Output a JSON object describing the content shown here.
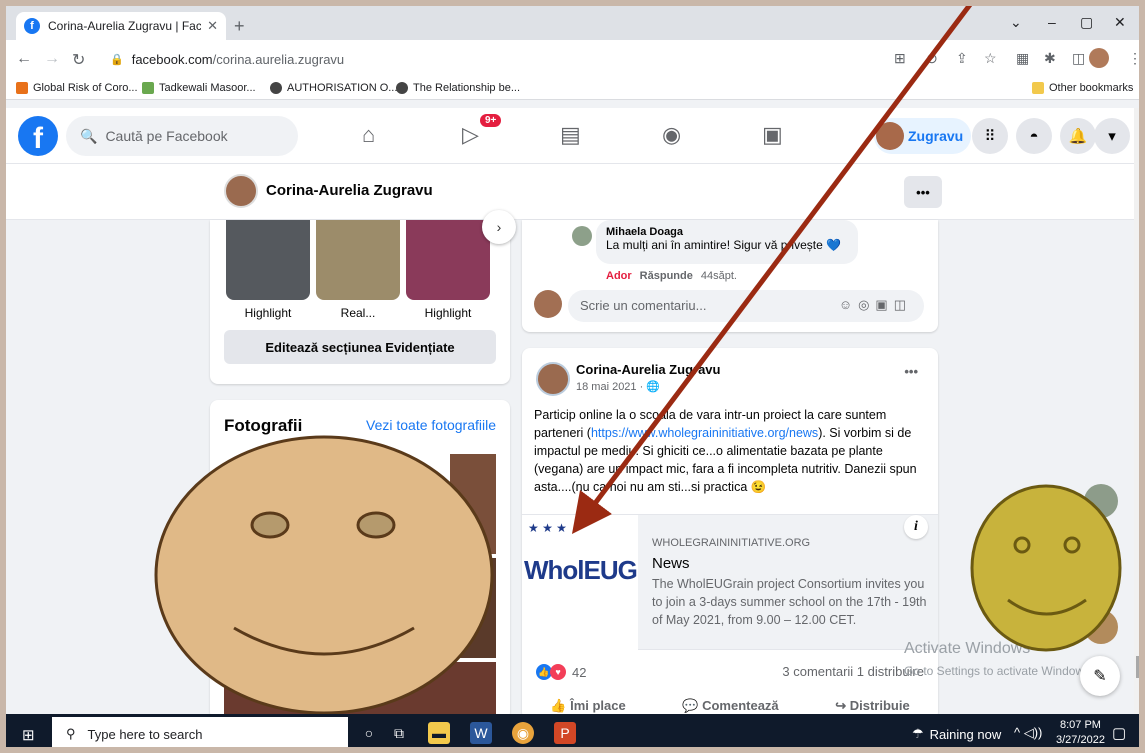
{
  "browser": {
    "tab_title": "Corina-Aurelia Zugravu | Facebook",
    "tab_close": "✕",
    "new_tab": "+",
    "url_domain": "facebook.com",
    "url_path": "/corina.aurelia.zugravu",
    "window_controls": [
      "⌄",
      "–",
      "▢",
      "✕"
    ]
  },
  "bookmarks": [
    {
      "label": "Global Risk of Coro...",
      "color": "#e8711a"
    },
    {
      "label": "Tadkewali Masoor...",
      "color": "#6aa84f"
    },
    {
      "label": "AUTHORISATION O...",
      "color": "#444444"
    },
    {
      "label": "The Relationship be...",
      "color": "#444444"
    }
  ],
  "other_bookmarks": "Other bookmarks",
  "facebook": {
    "logo": "f",
    "search_placeholder": "Caută pe Facebook",
    "video_badge": "9+",
    "user_chip": "Zugravu"
  },
  "profile": {
    "name": "Corina-Aurelia Zugravu",
    "more": "•••"
  },
  "highlights": {
    "items": [
      {
        "label": "Highlight",
        "color": "#55595e"
      },
      {
        "label": "Real...",
        "color": "#9c8c6a"
      },
      {
        "label": "Highlight",
        "color": "#8a3a5a"
      }
    ],
    "edit_button": "Editează secțiunea Evidențiate"
  },
  "photos": {
    "title": "Fotografii",
    "see_all": "Vezi toate fotografiile"
  },
  "comment": {
    "author": "Mihaela Doaga",
    "text": "La mulți ani în amintire! Sigur vă privește 💙",
    "reaction_label": "Ador",
    "reply_label": "Răspunde",
    "age": "44săpt.",
    "write_placeholder": "Scrie un comentariu..."
  },
  "post": {
    "author": "Corina-Aurelia Zugravu",
    "date": "18 mai 2021 · 🌐",
    "more": "•••",
    "text_before_link": "Particip online la o scoala de vara intr-un proiect la care suntem parteneri (",
    "link": "https://www.wholegraininitiative.org/news",
    "text_after_link": "). Si vorbim si de impactul pe mediu. Si ghiciti ce...o alimentatie bazata pe plante (vegana) are un impact mic, fara a fi incompleta nutritiv. Danezii spun asta....(nu ca noi nu am sti...si practica 😉",
    "preview": {
      "brand": "WholEUGrain",
      "domain": "WHOLEGRAININITIATIVE.ORG",
      "title": "News",
      "description": "The WholEUGrain project Consortium invites you to join a 3-days summer school on the 17th - 19th of May 2021, from 9.00 – 12.00 CET.",
      "info": "i"
    },
    "reaction_count": "42",
    "stats": "3 comentarii  1 distribuire",
    "actions": [
      "👍 Îmi place",
      "💬 Comentează",
      "↪ Distribuie"
    ]
  },
  "windows": {
    "activate_title": "Activate Windows",
    "activate_sub": "Go to Settings to activate Windows.",
    "search_placeholder": "Type here to search",
    "weather": "Raining now",
    "time": "8:07 PM",
    "date": "3/27/2022"
  },
  "colors": {
    "facebook_blue": "#1877f2",
    "arrow": "#9b2a12",
    "smiley_left": "#e0b987",
    "smiley_right": "#c8b33c"
  }
}
